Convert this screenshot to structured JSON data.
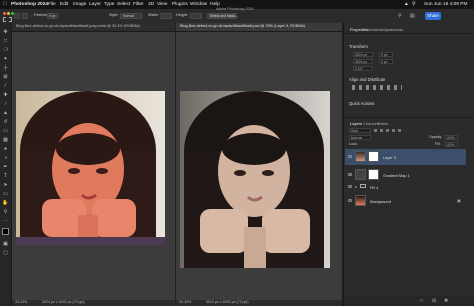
{
  "menubar": {
    "app": "Photoshop 2024",
    "items": [
      "File",
      "Edit",
      "Image",
      "Layer",
      "Type",
      "Select",
      "Filter",
      "3D",
      "View",
      "Plugins",
      "Window",
      "Help"
    ],
    "clock": "Sun Jun 16 4:09 PM"
  },
  "options_bar": {
    "feather_label": "Feather:",
    "feather_value": "0 px",
    "style_label": "Style:",
    "style_value": "Normal",
    "width_label": "Width:",
    "height_label": "Height:",
    "select_mask_button": "Select and Mask...",
    "window_title": "Adobe Photoshop 2024",
    "share_button": "Share"
  },
  "documents": [
    {
      "tab_title": "Blog-Bez-defect-vs-gn-rb-tapisoffdaulitfsskl.jpeg.extra @ 33.3% (RGB/8#)",
      "zoom": "33.33%",
      "status": "3024 px x 4032 px (72 ppi)"
    },
    {
      "tab_title": "Blog-Bez-defect-vs-gn-rb-tapisoffdaulitfsskl.psd @ 33% (Layer 3, RGB/8#)",
      "zoom": "33.33%",
      "status": "3024 px x 4032 px (72 ppi)"
    }
  ],
  "panels": {
    "tabs": [
      "Properties",
      "Libraries",
      "Adjustments"
    ],
    "transform_label": "Transform",
    "w_value": "3024 px",
    "h_value": "3024 px",
    "x_value": "0 px",
    "y_value": "0 px",
    "angle_value": "0.00°",
    "align_label": "Align and Distribute",
    "quick_actions_label": "Quick Actions",
    "layers_tabs": [
      "Layers",
      "Channels",
      "Paths"
    ],
    "kind_label": "Kind",
    "blend_mode": "Normal",
    "opacity_label": "Opacity:",
    "opacity_value": "100%",
    "lock_label": "Lock:",
    "fill_label": "Fill:",
    "fill_value": "100%",
    "layers": [
      "Layer 3",
      "Gradient Map 1",
      "Fill 4",
      "Background"
    ]
  }
}
